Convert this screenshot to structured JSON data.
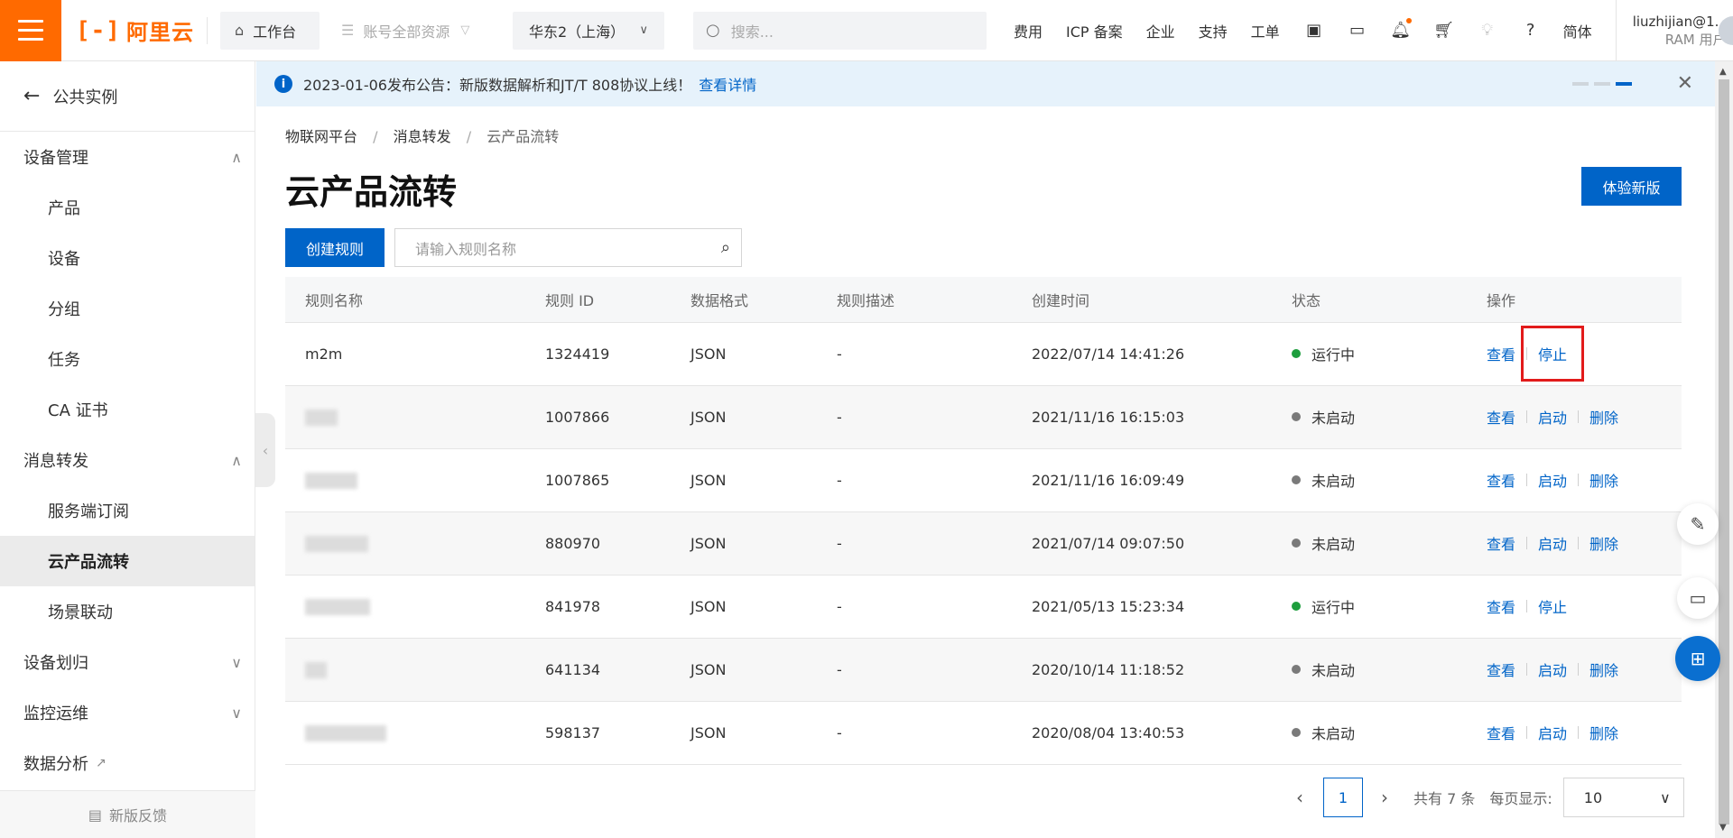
{
  "topbar": {
    "logo_text": "阿里云",
    "workbench_label": "工作台",
    "resource_label": "账号全部资源",
    "region_label": "华东2（上海）",
    "search_placeholder": "搜索...",
    "nav": [
      "费用",
      "ICP 备案",
      "企业",
      "支持",
      "工单"
    ],
    "lang_label": "简体",
    "user_name": "liuzhijian@1...",
    "user_role": "RAM 用户"
  },
  "sidebar": {
    "back_label": "公共实例",
    "groups": {
      "device_mgmt": "设备管理",
      "msg_forward": "消息转发",
      "device_assign": "设备划归",
      "monitor": "监控运维"
    },
    "items": {
      "product": "产品",
      "device": "设备",
      "group": "分组",
      "task": "任务",
      "ca": "CA 证书",
      "server_sub": "服务端订阅",
      "cloud_flow": "云产品流转",
      "scene": "场景联动"
    },
    "data_analysis": "数据分析",
    "feedback_label": "新版反馈"
  },
  "notice": {
    "text": "2023-01-06发布公告：新版数据解析和JT/T 808协议上线！",
    "link": "查看详情"
  },
  "breadcrumb": [
    "物联网平台",
    "消息转发",
    "云产品流转"
  ],
  "page": {
    "title": "云产品流转",
    "try_new_label": "体验新版",
    "create_label": "创建规则",
    "search_placeholder": "请输入规则名称"
  },
  "table": {
    "headers": [
      "规则名称",
      "规则 ID",
      "数据格式",
      "规则描述",
      "创建时间",
      "状态",
      "操作"
    ],
    "rows": [
      {
        "name": "m2m",
        "id": "1324419",
        "format": "JSON",
        "desc": "-",
        "time": "2022/07/14 14:41:26",
        "status": "运行中",
        "ops": [
          "查看",
          "停止"
        ]
      },
      {
        "name": "",
        "id": "1007866",
        "format": "JSON",
        "desc": "-",
        "time": "2021/11/16 16:15:03",
        "status": "未启动",
        "ops": [
          "查看",
          "启动",
          "删除"
        ]
      },
      {
        "name": "",
        "id": "1007865",
        "format": "JSON",
        "desc": "-",
        "time": "2021/11/16 16:09:49",
        "status": "未启动",
        "ops": [
          "查看",
          "启动",
          "删除"
        ]
      },
      {
        "name": "",
        "id": "880970",
        "format": "JSON",
        "desc": "-",
        "time": "2021/07/14 09:07:50",
        "status": "未启动",
        "ops": [
          "查看",
          "启动",
          "删除"
        ]
      },
      {
        "name": "",
        "id": "841978",
        "format": "JSON",
        "desc": "-",
        "time": "2021/05/13 15:23:34",
        "status": "运行中",
        "ops": [
          "查看",
          "停止"
        ]
      },
      {
        "name": "",
        "id": "641134",
        "format": "JSON",
        "desc": "-",
        "time": "2020/10/14 11:18:52",
        "status": "未启动",
        "ops": [
          "查看",
          "启动",
          "删除"
        ]
      },
      {
        "name": "",
        "id": "598137",
        "format": "JSON",
        "desc": "-",
        "time": "2020/08/04 13:40:53",
        "status": "未启动",
        "ops": [
          "查看",
          "启动",
          "删除"
        ]
      }
    ]
  },
  "pager": {
    "current": "1",
    "total_text": "共有 7 条",
    "per_page_label": "每页显示:",
    "per_page_value": "10"
  },
  "colors": {
    "brand": "#ff6a00",
    "primary": "#0064c8",
    "running": "#1e9e3e",
    "stopped": "#7a7a7a",
    "highlight": "#e21b1b"
  }
}
